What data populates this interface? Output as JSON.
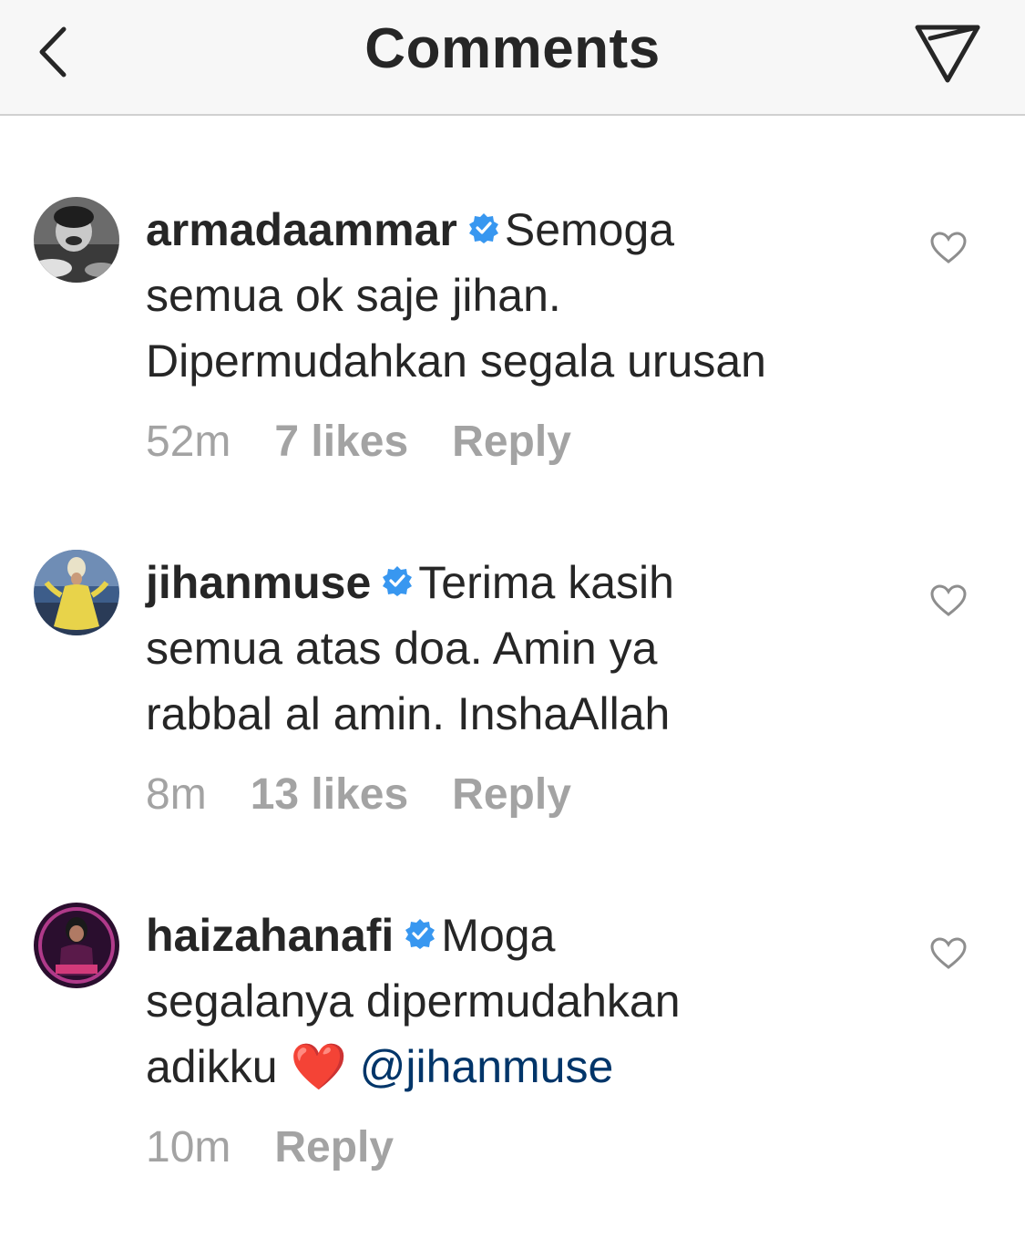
{
  "header": {
    "title": "Comments",
    "back_icon": "chevron-left-icon",
    "send_icon": "paper-plane-icon"
  },
  "colors": {
    "verified": "#3897f0",
    "mention": "#003569",
    "meta": "#a3a3a3",
    "text": "#262626",
    "heart": "#e0202d"
  },
  "comments": [
    {
      "username": "armadaammar",
      "verified": true,
      "lines": [
        "Semoga",
        "semua ok saje jihan.",
        "Dipermudahkan segala urusan"
      ],
      "time": "52m",
      "likes": "7 likes",
      "reply": "Reply"
    },
    {
      "username": "jihanmuse",
      "verified": true,
      "lines": [
        "Terima kasih",
        "semua atas doa. Amin ya",
        "rabbal al amin. InshaAllah"
      ],
      "time": "8m",
      "likes": "13 likes",
      "reply": "Reply"
    },
    {
      "username": "haizahanafi",
      "verified": true,
      "lines": [
        "Moga",
        "segalanya dipermudahkan",
        "adikku"
      ],
      "emoji": "❤️",
      "mention": "@jihanmuse",
      "time": "10m",
      "reply": "Reply"
    }
  ]
}
